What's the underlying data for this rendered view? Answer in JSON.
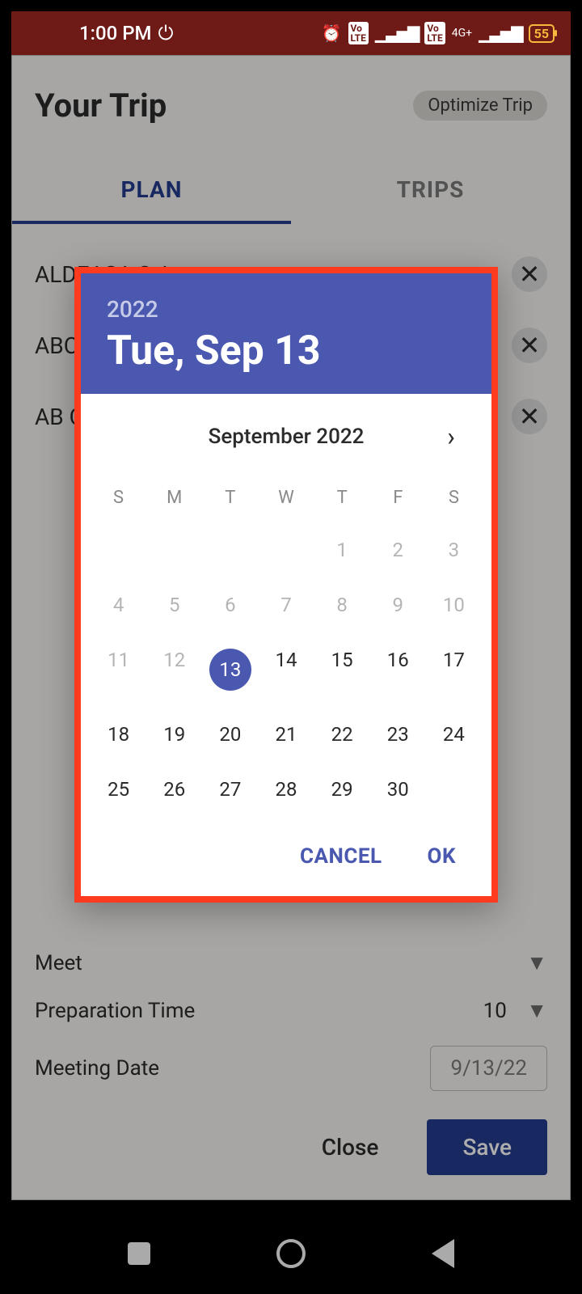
{
  "status": {
    "time": "1:00 PM",
    "battery": "55",
    "network": "4G+"
  },
  "page": {
    "title": "Your Trip",
    "optimize": "Optimize Trip"
  },
  "tabs": {
    "plan": "PLAN",
    "trips": "TRIPS"
  },
  "list": {
    "items": [
      {
        "name": "ALDEASA S.A"
      },
      {
        "name": "ABC"
      },
      {
        "name": "AB C"
      }
    ]
  },
  "form": {
    "meet_label": "Meet",
    "prep_label": "Preparation Time",
    "prep_value": "10",
    "date_label": "Meeting Date",
    "date_value": "9/13/22",
    "close": "Close",
    "save": "Save"
  },
  "datepicker": {
    "year": "2022",
    "headline": "Tue, Sep 13",
    "month_label": "September 2022",
    "dow": [
      "S",
      "M",
      "T",
      "W",
      "T",
      "F",
      "S"
    ],
    "days": [
      {
        "n": "",
        "cls": "empty"
      },
      {
        "n": "",
        "cls": "empty"
      },
      {
        "n": "",
        "cls": "empty"
      },
      {
        "n": "",
        "cls": "empty"
      },
      {
        "n": "1",
        "cls": "disabled"
      },
      {
        "n": "2",
        "cls": "disabled"
      },
      {
        "n": "3",
        "cls": "disabled"
      },
      {
        "n": "4",
        "cls": "disabled"
      },
      {
        "n": "5",
        "cls": "disabled"
      },
      {
        "n": "6",
        "cls": "disabled"
      },
      {
        "n": "7",
        "cls": "disabled"
      },
      {
        "n": "8",
        "cls": "disabled"
      },
      {
        "n": "9",
        "cls": "disabled"
      },
      {
        "n": "10",
        "cls": "disabled"
      },
      {
        "n": "11",
        "cls": "disabled"
      },
      {
        "n": "12",
        "cls": "disabled"
      },
      {
        "n": "13",
        "cls": "selected"
      },
      {
        "n": "14",
        "cls": ""
      },
      {
        "n": "15",
        "cls": ""
      },
      {
        "n": "16",
        "cls": ""
      },
      {
        "n": "17",
        "cls": ""
      },
      {
        "n": "18",
        "cls": ""
      },
      {
        "n": "19",
        "cls": ""
      },
      {
        "n": "20",
        "cls": ""
      },
      {
        "n": "21",
        "cls": ""
      },
      {
        "n": "22",
        "cls": ""
      },
      {
        "n": "23",
        "cls": ""
      },
      {
        "n": "24",
        "cls": ""
      },
      {
        "n": "25",
        "cls": ""
      },
      {
        "n": "26",
        "cls": ""
      },
      {
        "n": "27",
        "cls": ""
      },
      {
        "n": "28",
        "cls": ""
      },
      {
        "n": "29",
        "cls": ""
      },
      {
        "n": "30",
        "cls": ""
      },
      {
        "n": "",
        "cls": "empty"
      }
    ],
    "cancel": "CANCEL",
    "ok": "OK"
  }
}
